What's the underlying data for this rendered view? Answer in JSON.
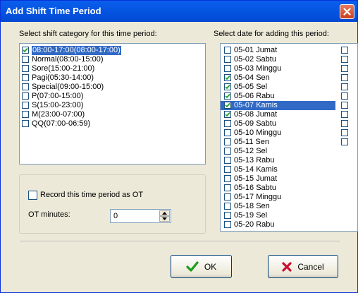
{
  "window": {
    "title": "Add Shift Time Period"
  },
  "shift_panel": {
    "label": "Select shift category for this time period:",
    "items": [
      {
        "text": "08:00-17:00(08:00-17:00)",
        "checked": true,
        "selected": true
      },
      {
        "text": "Normal(08:00-15:00)",
        "checked": false,
        "selected": false
      },
      {
        "text": "Sore(15:00-21:00)",
        "checked": false,
        "selected": false
      },
      {
        "text": "Pagi(05:30-14:00)",
        "checked": false,
        "selected": false
      },
      {
        "text": "Special(09:00-15:00)",
        "checked": false,
        "selected": false
      },
      {
        "text": "P(07:00-15:00)",
        "checked": false,
        "selected": false
      },
      {
        "text": "S(15:00-23:00)",
        "checked": false,
        "selected": false
      },
      {
        "text": "M(23:00-07:00)",
        "checked": false,
        "selected": false
      },
      {
        "text": "QQ(07:00-06:59)",
        "checked": false,
        "selected": false
      }
    ]
  },
  "ot": {
    "checkbox_label": "Record this time period as OT",
    "checked": false,
    "minutes_label": "OT minutes:",
    "minutes_value": "0"
  },
  "date_panel": {
    "label": "Select date for adding this period:",
    "items": [
      {
        "text": "05-01 Jumat",
        "checked": false,
        "selected": false
      },
      {
        "text": "05-02 Sabtu",
        "checked": false,
        "selected": false
      },
      {
        "text": "05-03 Minggu",
        "checked": false,
        "selected": false
      },
      {
        "text": "05-04 Sen",
        "checked": true,
        "selected": false
      },
      {
        "text": "05-05 Sel",
        "checked": true,
        "selected": false
      },
      {
        "text": "05-06 Rabu",
        "checked": true,
        "selected": false
      },
      {
        "text": "05-07 Kamis",
        "checked": true,
        "selected": true
      },
      {
        "text": "05-08 Jumat",
        "checked": true,
        "selected": false
      },
      {
        "text": "05-09 Sabtu",
        "checked": false,
        "selected": false
      },
      {
        "text": "05-10 Minggu",
        "checked": false,
        "selected": false
      },
      {
        "text": "05-11 Sen",
        "checked": false,
        "selected": false
      },
      {
        "text": "05-12 Sel",
        "checked": false,
        "selected": false
      },
      {
        "text": "05-13 Rabu",
        "checked": false,
        "selected": false
      },
      {
        "text": "05-14 Kamis",
        "checked": false,
        "selected": false
      },
      {
        "text": "05-15 Jumat",
        "checked": false,
        "selected": false
      },
      {
        "text": "05-16 Sabtu",
        "checked": false,
        "selected": false
      },
      {
        "text": "05-17 Minggu",
        "checked": false,
        "selected": false
      },
      {
        "text": "05-18 Sen",
        "checked": false,
        "selected": false
      },
      {
        "text": "05-19 Sel",
        "checked": false,
        "selected": false
      },
      {
        "text": "05-20 Rabu",
        "checked": false,
        "selected": false
      }
    ],
    "second_column_checkboxes": 11
  },
  "buttons": {
    "ok_label": "OK",
    "cancel_label": "Cancel"
  },
  "icons": {
    "close": "close-icon",
    "check": "checkmark-icon",
    "ok": "green-check-icon",
    "cancel": "red-x-icon"
  }
}
